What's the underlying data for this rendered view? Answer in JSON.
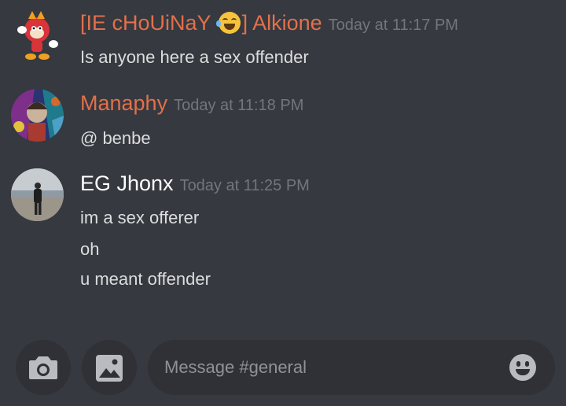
{
  "messages": [
    {
      "author_prefix": "[IE cHoUiNaY",
      "author_suffix": "] Alkione",
      "author_color": "#e2704b",
      "timestamp": "Today at 11:17 PM",
      "lines": [
        "Is anyone here a sex offender"
      ],
      "avatar_icon": "cartoon-character-avatar"
    },
    {
      "author": "Manaphy",
      "author_color": "#e2704b",
      "timestamp": "Today at 11:18 PM",
      "lines": [
        "@ benbe"
      ],
      "avatar_icon": "comic-artwork-avatar"
    },
    {
      "author": "EG Jhonx",
      "author_color": "#ffffff",
      "timestamp": "Today at 11:25 PM",
      "lines": [
        "im a sex offerer",
        "oh",
        "u meant offender"
      ],
      "avatar_icon": "beach-photo-avatar"
    }
  ],
  "composer": {
    "placeholder": "Message #general",
    "camera_icon": "camera-icon",
    "gallery_icon": "image-icon",
    "emoji_icon": "emoji-icon"
  },
  "colors": {
    "background": "#36393f",
    "input_background": "#2f3136",
    "timestamp": "#72767d"
  }
}
